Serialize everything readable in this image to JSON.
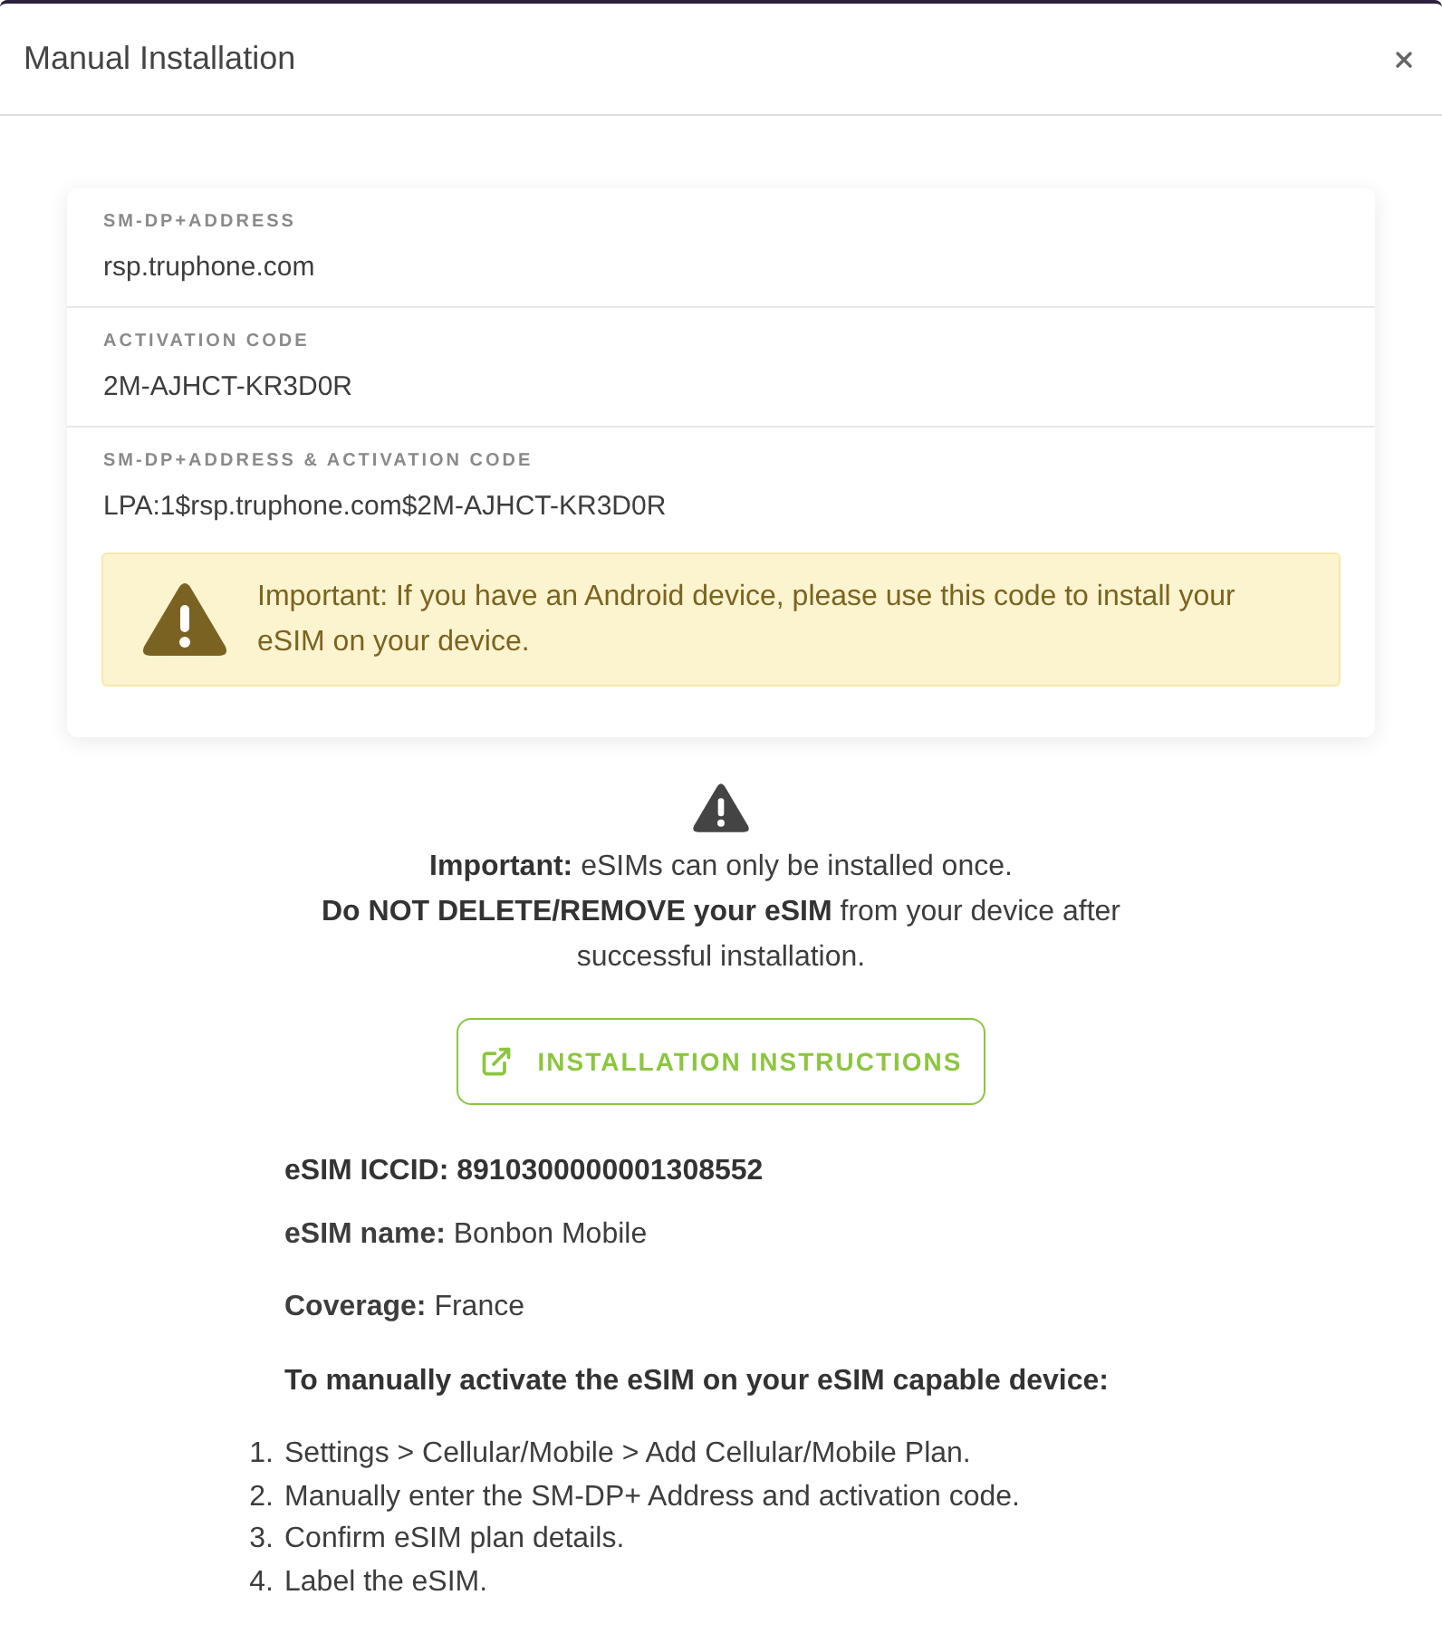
{
  "dialog": {
    "title": "Manual Installation"
  },
  "credentials_card": {
    "fields": [
      {
        "label": "SM-DP+ADDRESS",
        "value": "rsp.truphone.com"
      },
      {
        "label": "ACTIVATION CODE",
        "value": "2M-AJHCT-KR3D0R"
      },
      {
        "label": "SM-DP+ADDRESS & ACTIVATION CODE",
        "value": "LPA:1$rsp.truphone.com$2M-AJHCT-KR3D0R"
      }
    ],
    "notice": "Important: If you have an Android device, please use this code to install your eSIM on your device."
  },
  "caution": {
    "lines": [
      "**Important:** eSIMs can only be installed once.",
      "**Do NOT DELETE/REMOVE your eSIM** from your device after successful installation."
    ]
  },
  "instructions_button": {
    "label": "INSTALLATION INSTRUCTIONS"
  },
  "details": {
    "iccid": "eSIM ICCID: 8910300000001308552",
    "name": "**eSIM name:** Bonbon Mobile",
    "coverage": "**Coverage:** France",
    "heading": "To manually activate the eSIM on your eSIM capable device:"
  },
  "steps": [
    {
      "number": "1.",
      "text": "Settings > Cellular/Mobile > Add Cellular/Mobile Plan."
    },
    {
      "number": "2.",
      "text": "Manually enter the SM-DP+ Address and activation code."
    },
    {
      "number": "3.",
      "text": "Confirm eSIM plan details."
    },
    {
      "number": "4.",
      "text": "Label the eSIM."
    }
  ]
}
